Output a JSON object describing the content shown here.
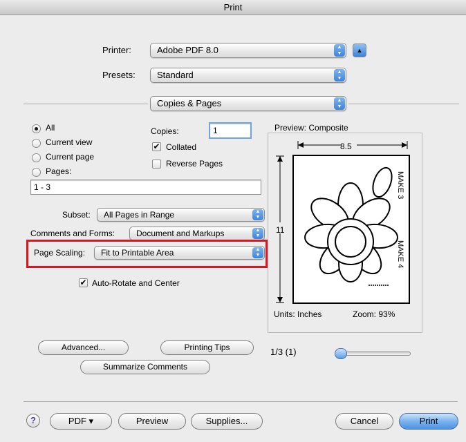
{
  "window": {
    "title": "Print"
  },
  "printer": {
    "label": "Printer:",
    "value": "Adobe PDF 8.0",
    "expand_icon": "disclosure-up-arrow"
  },
  "presets": {
    "label": "Presets:",
    "value": "Standard"
  },
  "section": {
    "value": "Copies & Pages"
  },
  "range": {
    "all": "All",
    "current_view": "Current view",
    "current_page": "Current page",
    "pages": "Pages:",
    "pages_value": "1 - 3",
    "selected": "All"
  },
  "copies": {
    "label": "Copies:",
    "value": "1",
    "collated": "Collated",
    "collated_checked": true,
    "reverse": "Reverse Pages",
    "reverse_checked": false
  },
  "subset": {
    "label": "Subset:",
    "value": "All Pages in Range"
  },
  "comments_forms": {
    "label": "Comments and Forms:",
    "value": "Document and Markups"
  },
  "page_scaling": {
    "label": "Page Scaling:",
    "value": "Fit to Printable Area"
  },
  "auto_rotate": {
    "label": "Auto-Rotate and Center",
    "checked": true
  },
  "preview": {
    "title": "Preview: Composite",
    "width": "8.5",
    "height": "11",
    "units": "Units: Inches",
    "zoom": "Zoom:  93%",
    "page_text_top": "MAKE 3",
    "page_text_bottom": "MAKE 4",
    "page_indicator": "1/3 (1)",
    "page_fraction": 0.0
  },
  "buttons": {
    "advanced": "Advanced...",
    "printing_tips": "Printing Tips",
    "summarize": "Summarize Comments",
    "help": "?",
    "pdf": "PDF ▾",
    "preview": "Preview",
    "supplies": "Supplies...",
    "cancel": "Cancel",
    "print": "Print"
  },
  "colors": {
    "highlight": "#e0141e",
    "accent": "#4b93e3"
  }
}
